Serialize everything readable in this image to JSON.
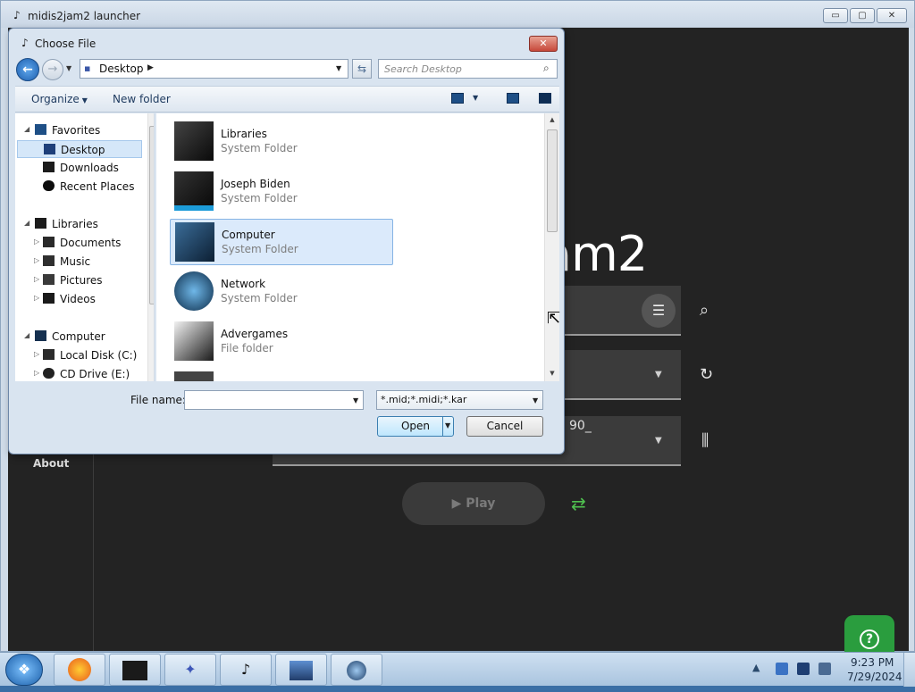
{
  "app": {
    "title": "midis2jam2 launcher",
    "controls": {
      "minimize": "▭",
      "maximize": "▢",
      "close": "✕"
    },
    "big_title": "am2",
    "sidebar": {
      "about": "About"
    },
    "fields": {
      "field3_text": "90_"
    },
    "play_label": "▶  Play",
    "icons": {
      "list": "list-icon",
      "search": "search-icon",
      "refresh": "refresh-icon",
      "audio": "audio-wave-icon",
      "repeat": "repeat-icon",
      "help": "help-icon"
    }
  },
  "dialog": {
    "title": "Choose File",
    "address": {
      "location": "Desktop"
    },
    "search": {
      "placeholder": "Search Desktop"
    },
    "toolbar": {
      "organize": "Organize",
      "new_folder": "New folder"
    },
    "nav": {
      "favorites": "Favorites",
      "desktop": "Desktop",
      "downloads": "Downloads",
      "recent": "Recent Places",
      "libraries": "Libraries",
      "documents": "Documents",
      "music": "Music",
      "pictures": "Pictures",
      "videos": "Videos",
      "computer": "Computer",
      "local_disk": "Local Disk (C:)",
      "cd_drive": "CD Drive (E:)"
    },
    "files": [
      {
        "name": "Libraries",
        "type": "System Folder"
      },
      {
        "name": "Joseph Biden",
        "type": "System Folder"
      },
      {
        "name": "Computer",
        "type": "System Folder"
      },
      {
        "name": "Network",
        "type": "System Folder"
      },
      {
        "name": "Advergames",
        "type": "File folder"
      }
    ],
    "file_name_label": "File name:",
    "file_name_value": "",
    "file_types": "*.mid;*.midi;*.kar",
    "open_label": "Open",
    "cancel_label": "Cancel"
  },
  "taskbar": {
    "time": "9:23 PM",
    "date": "7/29/2024",
    "tray_arrow": "▲"
  }
}
